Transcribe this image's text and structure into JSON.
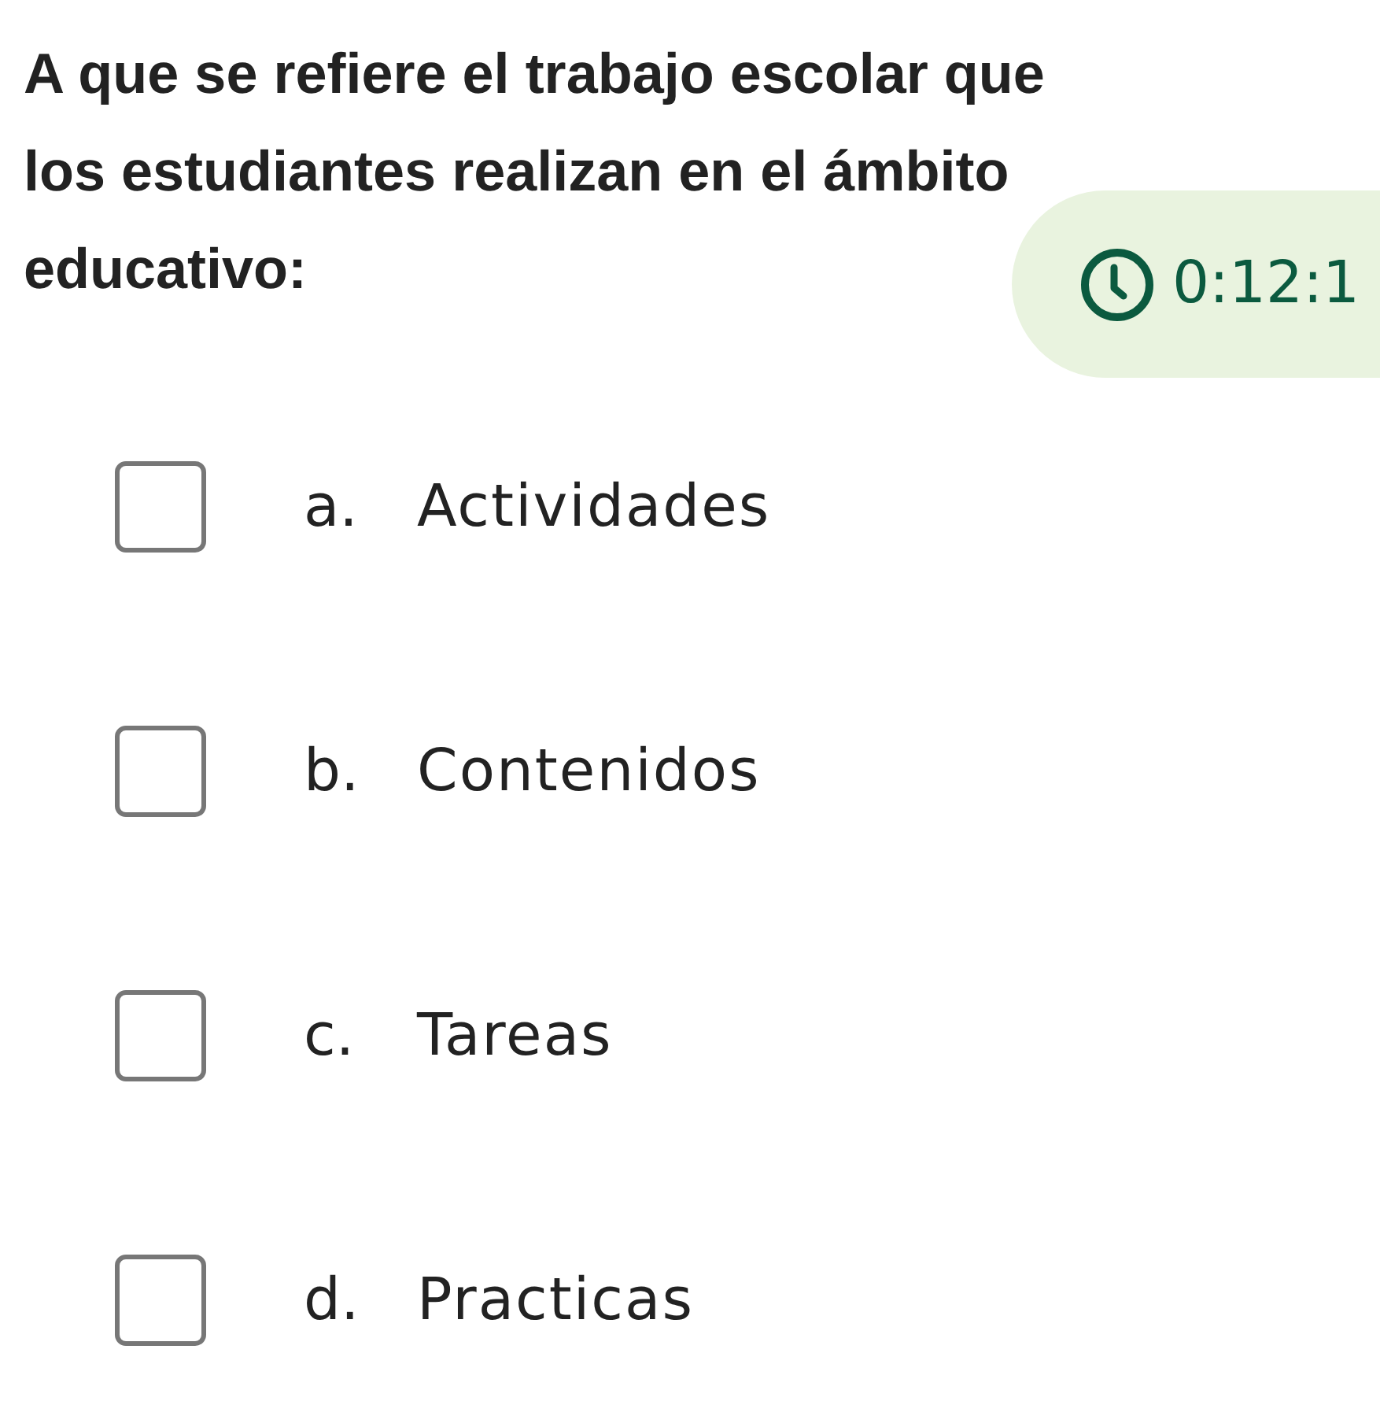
{
  "question": "A que se refiere el trabajo escolar que los estudiantes realizan en el ámbito educativo:",
  "timer": {
    "time": "0:12:1"
  },
  "options": [
    {
      "letter": "a.",
      "text": "Actividades",
      "checked": false
    },
    {
      "letter": "b.",
      "text": "Contenidos",
      "checked": false
    },
    {
      "letter": "c.",
      "text": "Tareas",
      "checked": false
    },
    {
      "letter": "d.",
      "text": "Practicas",
      "checked": false
    }
  ]
}
